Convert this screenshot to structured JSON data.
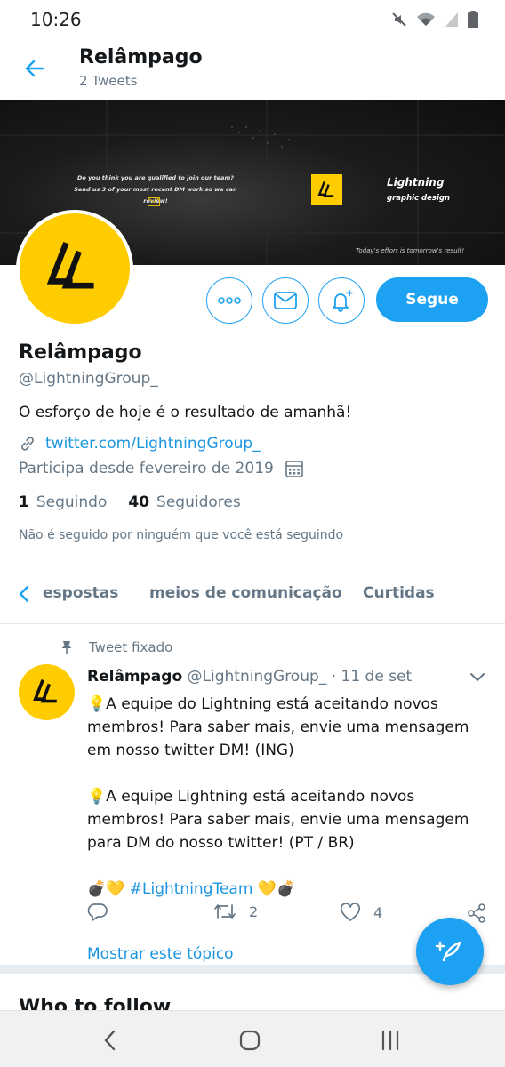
{
  "status_bar": {
    "time": "10:26",
    "icons": [
      "mute-icon",
      "wifi-icon",
      "signal-icon",
      "battery-icon"
    ]
  },
  "header": {
    "title": "Relâmpago",
    "subtitle": "2 Tweets"
  },
  "banner": {
    "question_line1": "Do you think you are qualified to join our team?",
    "question_line2": "Send us 3 of your most recent DM work so we can review!",
    "brand_name": "Lightning",
    "brand_tagline": "graphic design",
    "motto": "Today's effort is tomorrow's result!"
  },
  "actions": {
    "more_icon": "more-icon",
    "message_icon": "mail-icon",
    "notify_icon": "bell-plus-icon",
    "follow_label": "Segue"
  },
  "profile": {
    "name": "Relâmpago",
    "handle": "@LightningGroup_",
    "bio": "O esforço de hoje é o resultado de amanhã!",
    "link": "twitter.com/LightningGroup_",
    "joined": "Participa desde fevereiro de 2019",
    "following_count": "1",
    "following_label": "Seguindo",
    "followers_count": "40",
    "followers_label": "Seguidores",
    "followed_by_note": "Não é seguido por ninguém que você está seguindo"
  },
  "tabs": [
    "espostas",
    "meios de comunicação",
    "Curtidas"
  ],
  "tweet": {
    "pinned_label": "Tweet fixado",
    "name": "Relâmpago",
    "handle": "@LightningGroup_",
    "separator": "·",
    "date": "11 de set",
    "lines": [
      "💡A equipe do Lightning está aceitando novos",
      "membros! Para saber mais, envie uma mensagem",
      "em nosso twitter DM! (ING)",
      "",
      "💡A equipe Lightning está aceitando novos",
      "membros! Para saber mais, envie uma mensagem",
      "para DM do nosso twitter! (PT / BR)",
      ""
    ],
    "emoji_left": "💣💛",
    "hashtag": "#LightningTeam",
    "emoji_right": "💛💣",
    "retweets": "2",
    "likes": "4",
    "show_thread": "Mostrar este tópico"
  },
  "section_title": "Who to follow",
  "colors": {
    "accent": "#1da1f2",
    "brand_yellow": "#ffcc00",
    "muted": "#657786"
  }
}
